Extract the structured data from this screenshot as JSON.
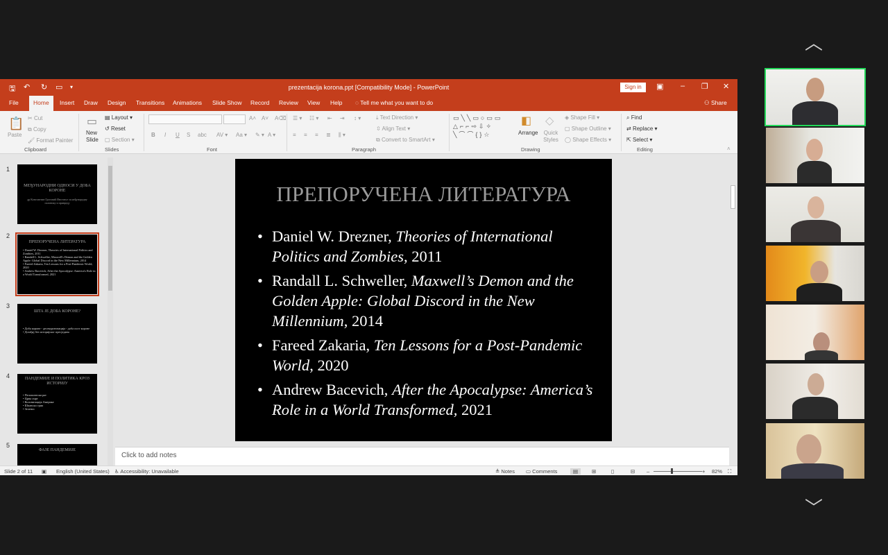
{
  "window": {
    "title": "prezentacija korona.ppt [Compatibility Mode]  -  PowerPoint",
    "sign_in": "Sign in",
    "share": "Share",
    "tell_me": "Tell me what you want to do"
  },
  "tabs": [
    "File",
    "Home",
    "Insert",
    "Draw",
    "Design",
    "Transitions",
    "Animations",
    "Slide Show",
    "Record",
    "Review",
    "View",
    "Help"
  ],
  "ribbon": {
    "clipboard": {
      "paste": "Paste",
      "cut": "Cut",
      "copy": "Copy",
      "format_painter": "Format Painter",
      "label": "Clipboard"
    },
    "slides": {
      "new_slide": "New Slide",
      "layout": "Layout",
      "reset": "Reset",
      "section": "Section",
      "label": "Slides"
    },
    "font": {
      "label": "Font",
      "bold": "B",
      "italic": "I",
      "underline": "U",
      "strike": "S",
      "shadow": "abc"
    },
    "paragraph": {
      "text_direction": "Text Direction",
      "align_text": "Align Text",
      "convert_smartart": "Convert to SmartArt",
      "label": "Paragraph"
    },
    "drawing": {
      "arrange": "Arrange",
      "quick_styles": "Quick Styles",
      "shape_fill": "Shape Fill",
      "shape_outline": "Shape Outline",
      "shape_effects": "Shape Effects",
      "label": "Drawing"
    },
    "editing": {
      "find": "Find",
      "replace": "Replace",
      "select": "Select",
      "label": "Editing"
    }
  },
  "thumbnails": [
    {
      "num": "1",
      "title": "МЕЂУНАРОДНИ ОДНОСИ У ДОБА КОРОНЕ",
      "sub": "др Константин Гроговић\nИнститут за међународну политику и привреду",
      "bullets": []
    },
    {
      "num": "2",
      "title": "ПРЕПОРУЧЕНА ЛИТЕРАТУРА",
      "sub": "",
      "bullets": [
        "Daniel W. Drezner, Theories of International Politics and Zombies, 2011",
        "Randall L. Schweller, Maxwell's Demon and the Golden Apple: Global Discord in the New Millennium, 2014",
        "Fareed Zakaria, Ten Lessons for a Post-Pandemic World, 2020",
        "Andrew Bacevich, After the Apocalypse: America's Role in a World Transformed, 2021"
      ]
    },
    {
      "num": "3",
      "title": "ШТА ЈЕ ДОБА КОРОНЕ?",
      "sub": "",
      "bullets": [
        "Доба короне - десекуритизација - доба пост короне",
        "Догађај без историјског пресједана"
      ]
    },
    {
      "num": "4",
      "title": "ПАНДЕМИЈЕ И ПОЛИТИКА КРОЗ ИСТОРИЈУ",
      "sub": "",
      "bullets": [
        "Пелопонески рат",
        "Црна смрт",
        "Колонизација Америке",
        "Шпански грип",
        "Зеленос"
      ]
    },
    {
      "num": "5",
      "title": "ФАЗЕ ПАНДЕМИЈЕ",
      "sub": "",
      "bullets": []
    }
  ],
  "slide": {
    "title": "ПРЕПОРУЧЕНА ЛИТЕРАТУРА",
    "items": [
      {
        "author": "Daniel W. Drezner, ",
        "work": "Theories of International Politics and Zombies",
        "year": ", 2011"
      },
      {
        "author": "Randall L. Schweller, ",
        "work": "Maxwell’s Demon and the Golden Apple: Global Discord in the New Millennium",
        "year": ", 2014"
      },
      {
        "author": "Fareed Zakaria, ",
        "work": "Ten Lessons for a Post-Pandemic World",
        "year": ", 2020"
      },
      {
        "author": "Andrew Bacevich, ",
        "work": "After the Apocalypse: America’s Role in a World Transformed,",
        "year": " 2021"
      }
    ]
  },
  "notes_placeholder": "Click to add notes",
  "status": {
    "slide_count": "Slide 2 of 11",
    "language": "English (United States)",
    "accessibility": "Accessibility: Unavailable",
    "notes": "Notes",
    "comments": "Comments",
    "zoom": "82%"
  },
  "colors": {
    "ppt_accent": "#c43e1c",
    "speaker_border": "#23d959"
  }
}
